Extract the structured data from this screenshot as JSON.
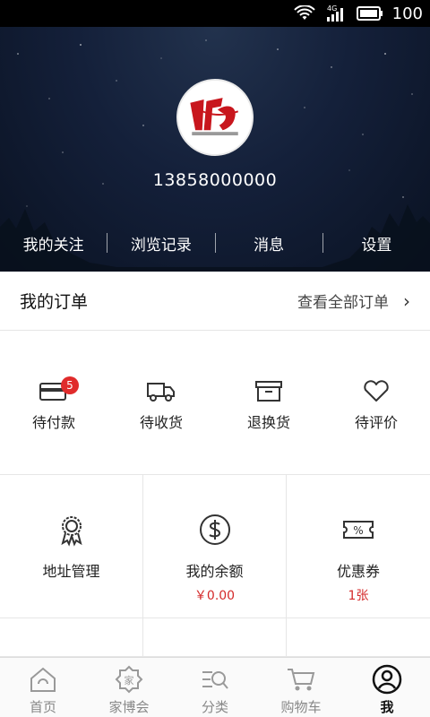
{
  "status_bar": {
    "network": "4G",
    "battery": "100"
  },
  "profile": {
    "phone": "13858000000"
  },
  "header_links": [
    {
      "label": "我的关注"
    },
    {
      "label": "浏览记录"
    },
    {
      "label": "消息"
    },
    {
      "label": "设置"
    }
  ],
  "orders": {
    "title": "我的订单",
    "view_all": "查看全部订单"
  },
  "order_statuses": [
    {
      "label": "待付款",
      "icon": "card-icon",
      "badge": "5"
    },
    {
      "label": "待收货",
      "icon": "truck-icon"
    },
    {
      "label": "退换货",
      "icon": "box-icon"
    },
    {
      "label": "待评价",
      "icon": "heart-icon"
    }
  ],
  "services": [
    {
      "label": "地址管理",
      "icon": "award-icon"
    },
    {
      "label": "我的余额",
      "icon": "dollar-icon",
      "value": "￥0.00"
    },
    {
      "label": "优惠券",
      "icon": "coupon-icon",
      "value": "1张"
    }
  ],
  "tabs": [
    {
      "label": "首页",
      "icon": "home-icon"
    },
    {
      "label": "家博会",
      "icon": "expo-icon"
    },
    {
      "label": "分类",
      "icon": "category-icon"
    },
    {
      "label": "购物车",
      "icon": "cart-icon"
    },
    {
      "label": "我",
      "icon": "user-icon",
      "active": true
    }
  ],
  "colors": {
    "accent_red": "#d42a2a",
    "badge_red": "#e02b2b",
    "header_bg": "#14203a"
  }
}
